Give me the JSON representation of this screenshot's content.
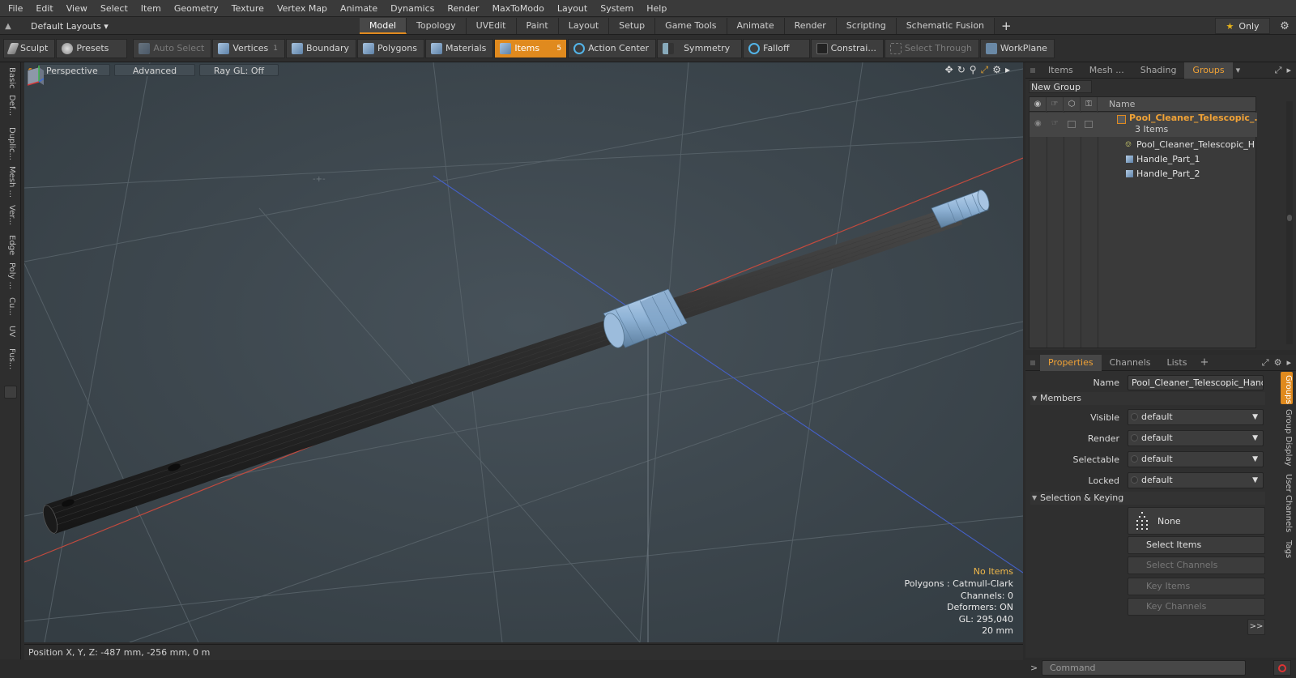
{
  "menu": [
    "File",
    "Edit",
    "View",
    "Select",
    "Item",
    "Geometry",
    "Texture",
    "Vertex Map",
    "Animate",
    "Dynamics",
    "Render",
    "MaxToModo",
    "Layout",
    "System",
    "Help"
  ],
  "layout_selector": "Default Layouts ▾",
  "mode_tabs": [
    "Model",
    "Topology",
    "UVEdit",
    "Paint",
    "Layout",
    "Setup",
    "Game Tools",
    "Animate",
    "Render",
    "Scripting",
    "Schematic Fusion"
  ],
  "mode_tab_active": "Model",
  "only_label": "Only",
  "toolbar": {
    "sculpt": "Sculpt",
    "presets": "Presets",
    "auto_select": "Auto Select",
    "vertices": "Vertices",
    "vertices_key": "1",
    "boundary": "Boundary",
    "polygons": "Polygons",
    "materials": "Materials",
    "items": "Items",
    "items_key": "5",
    "action_center": "Action Center",
    "symmetry": "Symmetry",
    "falloff": "Falloff",
    "constraints": "Constrai...",
    "select_through": "Select Through",
    "workplane": "WorkPlane"
  },
  "left_tabs": [
    "Basic",
    "Def...",
    "Duplic...",
    "Mesh ...",
    "Ver...",
    "Edge",
    "Poly ...",
    "Cu...",
    "UV",
    "Fus..."
  ],
  "viewport": {
    "perspective": "Perspective",
    "advanced": "Advanced",
    "raygl": "Ray GL: Off",
    "info": {
      "no_items": "No Items",
      "polygons": "Polygons : Catmull-Clark",
      "channels": "Channels: 0",
      "deformers": "Deformers: ON",
      "gl": "GL: 295,040",
      "scale": "20 mm"
    }
  },
  "status": "Position X, Y, Z:  -487 mm, -256 mm, 0 m",
  "groups_panel": {
    "tabs": [
      "Items",
      "Mesh ...",
      "Shading",
      "Groups"
    ],
    "active_tab": "Groups",
    "new_group": "New Group",
    "col_name": "Name",
    "group_name": "Pool_Cleaner_Telescopic_...",
    "group_count": "3 Items",
    "children": [
      "Pool_Cleaner_Telescopic_H ...",
      "Handle_Part_1",
      "Handle_Part_2"
    ]
  },
  "props_panel": {
    "tabs": [
      "Properties",
      "Channels",
      "Lists"
    ],
    "active_tab": "Properties",
    "name_label": "Name",
    "name_value": "Pool_Cleaner_Telescopic_Handle",
    "members_section": "Members",
    "visible_label": "Visible",
    "visible_value": "default",
    "render_label": "Render",
    "render_value": "default",
    "selectable_label": "Selectable",
    "selectable_value": "default",
    "locked_label": "Locked",
    "locked_value": "default",
    "sel_keying_section": "Selection & Keying",
    "none_label": "None",
    "select_items": "Select Items",
    "select_channels": "Select Channels",
    "key_items": "Key Items",
    "key_channels": "Key Channels",
    "more": ">>",
    "side_tabs": [
      "Groups",
      "Group Display",
      "User Channels",
      "Tags"
    ]
  },
  "command": {
    "prompt": ">",
    "placeholder": "Command"
  },
  "colors": {
    "accent": "#e08a1e",
    "viewport_bg": "#3c464d",
    "metal_blue": "#8fb3d6",
    "pole_dark": "#2e2e2e"
  }
}
